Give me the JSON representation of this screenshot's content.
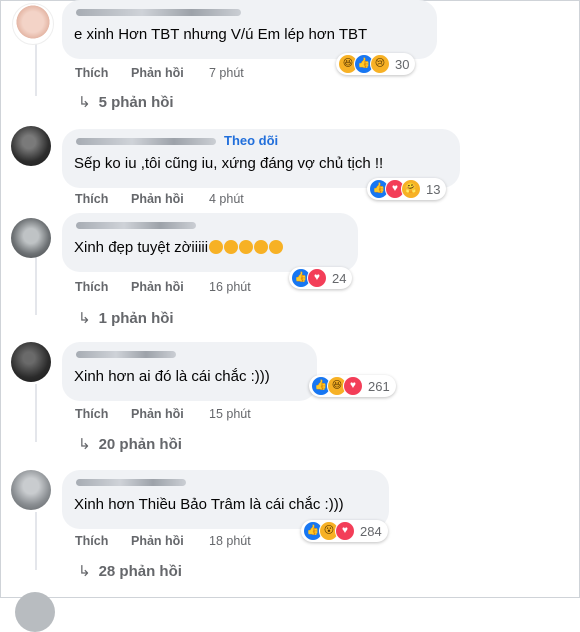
{
  "actions": {
    "like": "Thích",
    "reply": "Phản hồi"
  },
  "follow_label": "Theo dõi",
  "comments": [
    {
      "text": "e xinh Hơn TBT nhưng V/ú Em lép hơn TBT",
      "time": "7 phút",
      "reaction_count": "30",
      "reply_link": "5 phản hồi",
      "emoji_suffix": ""
    },
    {
      "text": "Sếp ko iu ,tôi cũng iu, xứng đáng vợ chủ tịch !!",
      "time": "4 phút",
      "reaction_count": "13",
      "reply_link": "",
      "emoji_suffix": ""
    },
    {
      "text": "Xinh đẹp tuyệt zờiiiii",
      "time": "16 phút",
      "reaction_count": "24",
      "reply_link": "1 phản hồi",
      "emoji_suffix": "😊😊🥰🥰🥰"
    },
    {
      "text": "Xinh hơn ai đó là cái chắc :)))",
      "time": "15 phút",
      "reaction_count": "261",
      "reply_link": "20 phản hồi",
      "emoji_suffix": ""
    },
    {
      "text": "Xinh hơn Thiều Bảo Trâm là cái chắc :)))",
      "time": "18 phút",
      "reaction_count": "284",
      "reply_link": "28 phản hồi",
      "emoji_suffix": ""
    }
  ],
  "colors": {
    "bubble": "#f0f2f5",
    "link_blue": "#216fdb",
    "meta_gray": "#65676b",
    "like_blue": "#1877f2",
    "love_red": "#f33e58",
    "emoji_yellow": "#f7b125"
  },
  "icons": [
    "like-reaction-icon",
    "love-reaction-icon",
    "haha-reaction-icon",
    "sad-reaction-icon",
    "wow-reaction-icon",
    "care-reaction-icon",
    "reply-arrow-icon"
  ]
}
